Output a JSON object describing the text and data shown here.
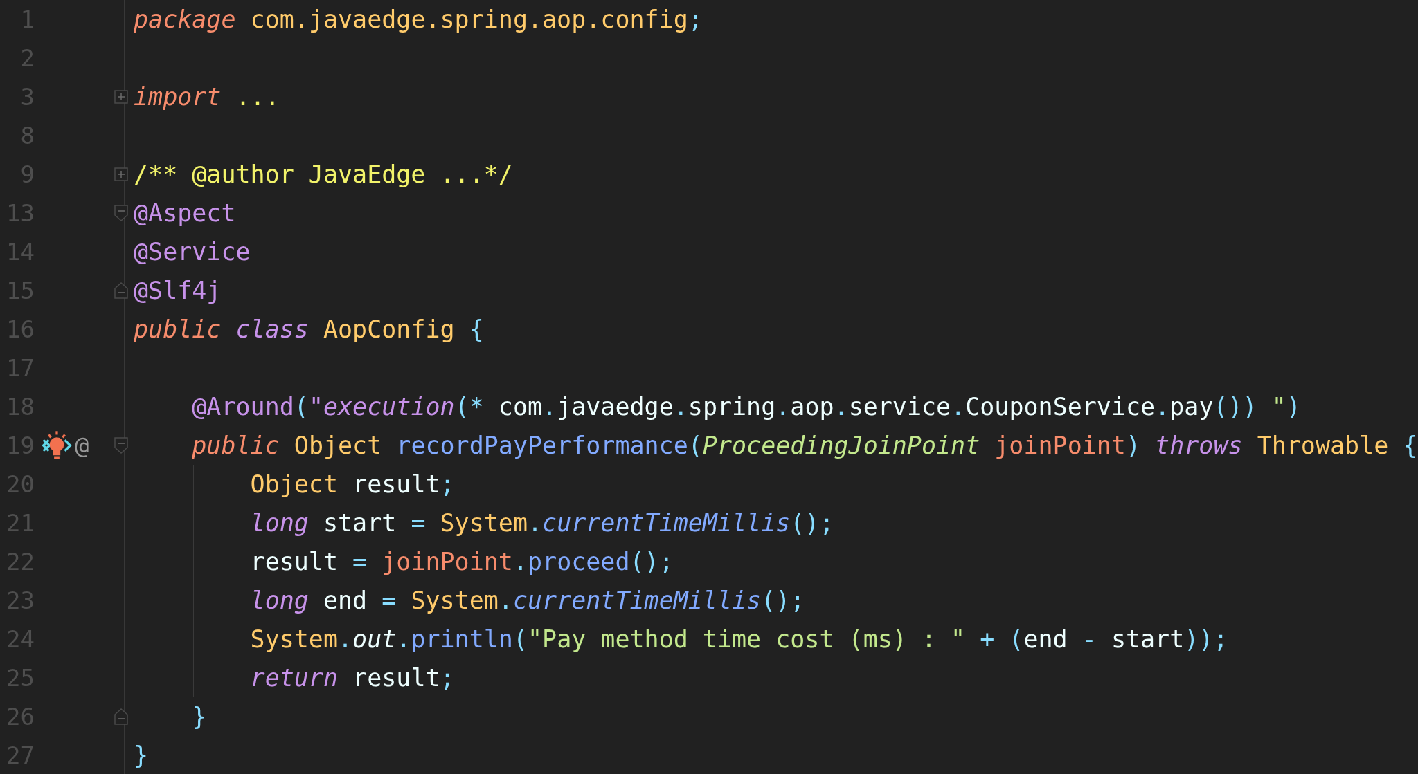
{
  "lines": [
    {
      "number": "1",
      "tokens": [
        {
          "text": "package ",
          "kind": "keyword"
        },
        {
          "text": "com.javaedge.spring.aop.config",
          "kind": "type"
        },
        {
          "text": ";",
          "kind": "punct"
        }
      ]
    },
    {
      "number": "2"
    },
    {
      "number": "3",
      "collapsed": true,
      "tokens": [
        {
          "text": "import ",
          "kind": "keyword"
        },
        {
          "text": "...",
          "kind": "comment"
        }
      ]
    },
    {
      "number": "8"
    },
    {
      "number": "9",
      "collapsed": true,
      "tokens": [
        {
          "text": "/** @author JavaEdge ...*/",
          "kind": "comment"
        }
      ]
    },
    {
      "number": "13",
      "fold_start": true,
      "tokens": [
        {
          "text": "@Aspect",
          "kind": "annotation"
        }
      ]
    },
    {
      "number": "14",
      "tokens": [
        {
          "text": "@Service",
          "kind": "annotation"
        }
      ]
    },
    {
      "number": "15",
      "fold_end": true,
      "tokens": [
        {
          "text": "@Slf4j",
          "kind": "annotation"
        }
      ]
    },
    {
      "number": "16",
      "tokens": [
        {
          "text": "public ",
          "kind": "keyword"
        },
        {
          "text": "class ",
          "kind": "modifier"
        },
        {
          "text": "AopConfig ",
          "kind": "type"
        },
        {
          "text": "{",
          "kind": "punct"
        }
      ]
    },
    {
      "number": "17"
    },
    {
      "number": "18",
      "tokens": [
        {
          "text": "    @Around",
          "kind": "annotation"
        },
        {
          "text": "(",
          "kind": "punct"
        },
        {
          "text": "\"",
          "kind": "annotation"
        },
        {
          "text": "execution",
          "kind": "modifier"
        },
        {
          "text": "(*",
          "kind": "punct"
        },
        {
          "text": " com",
          "kind": "plain"
        },
        {
          "text": ".",
          "kind": "punct"
        },
        {
          "text": "javaedge",
          "kind": "plain"
        },
        {
          "text": ".",
          "kind": "punct"
        },
        {
          "text": "spring",
          "kind": "plain"
        },
        {
          "text": ".",
          "kind": "punct"
        },
        {
          "text": "aop",
          "kind": "plain"
        },
        {
          "text": ".",
          "kind": "punct"
        },
        {
          "text": "service",
          "kind": "plain"
        },
        {
          "text": ".",
          "kind": "punct"
        },
        {
          "text": "CouponService",
          "kind": "plain"
        },
        {
          "text": ".",
          "kind": "punct"
        },
        {
          "text": "pay",
          "kind": "plain"
        },
        {
          "text": "())",
          "kind": "punct"
        },
        {
          "text": " \"",
          "kind": "string"
        },
        {
          "text": ")",
          "kind": "punct"
        }
      ]
    },
    {
      "number": "19",
      "fold_start": true,
      "debug_marker": true,
      "implements_marker": "@",
      "tokens": [
        {
          "text": "    public ",
          "kind": "keyword"
        },
        {
          "text": "Object ",
          "kind": "type"
        },
        {
          "text": "recordPayPerformance",
          "kind": "method"
        },
        {
          "text": "(",
          "kind": "punct"
        },
        {
          "text": "ProceedingJoinPoint ",
          "kind": "param_type"
        },
        {
          "text": "joinPoint",
          "kind": "param"
        },
        {
          "text": ") ",
          "kind": "punct"
        },
        {
          "text": "throws ",
          "kind": "modifier"
        },
        {
          "text": "Throwable ",
          "kind": "type"
        },
        {
          "text": "{",
          "kind": "punct"
        }
      ]
    },
    {
      "number": "20",
      "indent_guide": true,
      "tokens": [
        {
          "text": "        Object ",
          "kind": "type"
        },
        {
          "text": "result",
          "kind": "plain"
        },
        {
          "text": ";",
          "kind": "punct"
        }
      ]
    },
    {
      "number": "21",
      "indent_guide": true,
      "tokens": [
        {
          "text": "        long ",
          "kind": "modifier"
        },
        {
          "text": "start ",
          "kind": "plain"
        },
        {
          "text": "= ",
          "kind": "punct"
        },
        {
          "text": "System",
          "kind": "type"
        },
        {
          "text": ".",
          "kind": "punct"
        },
        {
          "text": "currentTimeMillis",
          "kind": "static_method"
        },
        {
          "text": "();",
          "kind": "punct"
        }
      ]
    },
    {
      "number": "22",
      "indent_guide": true,
      "tokens": [
        {
          "text": "        result ",
          "kind": "plain"
        },
        {
          "text": "= ",
          "kind": "punct"
        },
        {
          "text": "joinPoint",
          "kind": "param"
        },
        {
          "text": ".",
          "kind": "punct"
        },
        {
          "text": "proceed",
          "kind": "method"
        },
        {
          "text": "();",
          "kind": "punct"
        }
      ]
    },
    {
      "number": "23",
      "indent_guide": true,
      "tokens": [
        {
          "text": "        long ",
          "kind": "modifier"
        },
        {
          "text": "end ",
          "kind": "plain"
        },
        {
          "text": "= ",
          "kind": "punct"
        },
        {
          "text": "System",
          "kind": "type"
        },
        {
          "text": ".",
          "kind": "punct"
        },
        {
          "text": "currentTimeMillis",
          "kind": "static_method"
        },
        {
          "text": "();",
          "kind": "punct"
        }
      ]
    },
    {
      "number": "24",
      "indent_guide": true,
      "tokens": [
        {
          "text": "        System",
          "kind": "type"
        },
        {
          "text": ".",
          "kind": "punct"
        },
        {
          "text": "out",
          "kind": "static_field"
        },
        {
          "text": ".",
          "kind": "punct"
        },
        {
          "text": "println",
          "kind": "method"
        },
        {
          "text": "(",
          "kind": "punct"
        },
        {
          "text": "\"Pay method time cost (ms) : \" ",
          "kind": "string"
        },
        {
          "text": "+ (",
          "kind": "punct"
        },
        {
          "text": "end ",
          "kind": "plain"
        },
        {
          "text": "- ",
          "kind": "punct"
        },
        {
          "text": "start",
          "kind": "plain"
        },
        {
          "text": "));",
          "kind": "punct"
        }
      ]
    },
    {
      "number": "25",
      "indent_guide": true,
      "tokens": [
        {
          "text": "        return ",
          "kind": "modifier"
        },
        {
          "text": "result",
          "kind": "plain"
        },
        {
          "text": ";",
          "kind": "punct"
        }
      ]
    },
    {
      "number": "26",
      "fold_end": true,
      "tokens": [
        {
          "text": "    }",
          "kind": "punct"
        }
      ]
    },
    {
      "number": "27",
      "tokens": [
        {
          "text": "}",
          "kind": "punct"
        }
      ]
    }
  ]
}
